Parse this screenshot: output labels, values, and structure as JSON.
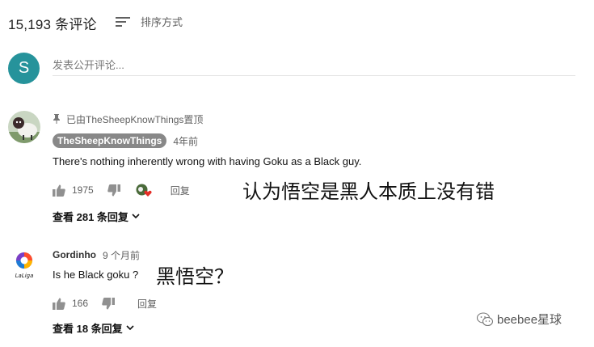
{
  "header": {
    "comment_count": "15,193 条评论",
    "sort_label": "排序方式"
  },
  "composer": {
    "avatar_letter": "S",
    "placeholder": "发表公开评论..."
  },
  "comments": [
    {
      "pinned_text": "已由TheSheepKnowThings置顶",
      "author": "TheSheepKnowThings",
      "time": "4年前",
      "text": "There's nothing inherently wrong with having Goku as a Black guy.",
      "likes": "1975",
      "reply_label": "回复",
      "view_replies": "查看 281 条回复"
    },
    {
      "author": "Gordinho",
      "time": "9 个月前",
      "text": "Is he Black goku ?",
      "likes": "166",
      "reply_label": "回复",
      "view_replies": "查看 18 条回复"
    }
  ],
  "overlays": {
    "caption1": "认为悟空是黑人本质上没有错",
    "caption2": "黑悟空？"
  },
  "watermark": {
    "text": "beebee星球"
  },
  "icons": {
    "sort": "sort-icon",
    "pin": "pin-icon",
    "like": "thumb-up-icon",
    "dislike": "thumb-down-icon",
    "creator_heart": "creator-heart-icon",
    "expand": "chevron-down-icon",
    "watermark": "wechat-icon"
  },
  "colors": {
    "avatar_bg": "#26939b",
    "author_badge_bg": "#888888",
    "heart": "#e52d27"
  }
}
